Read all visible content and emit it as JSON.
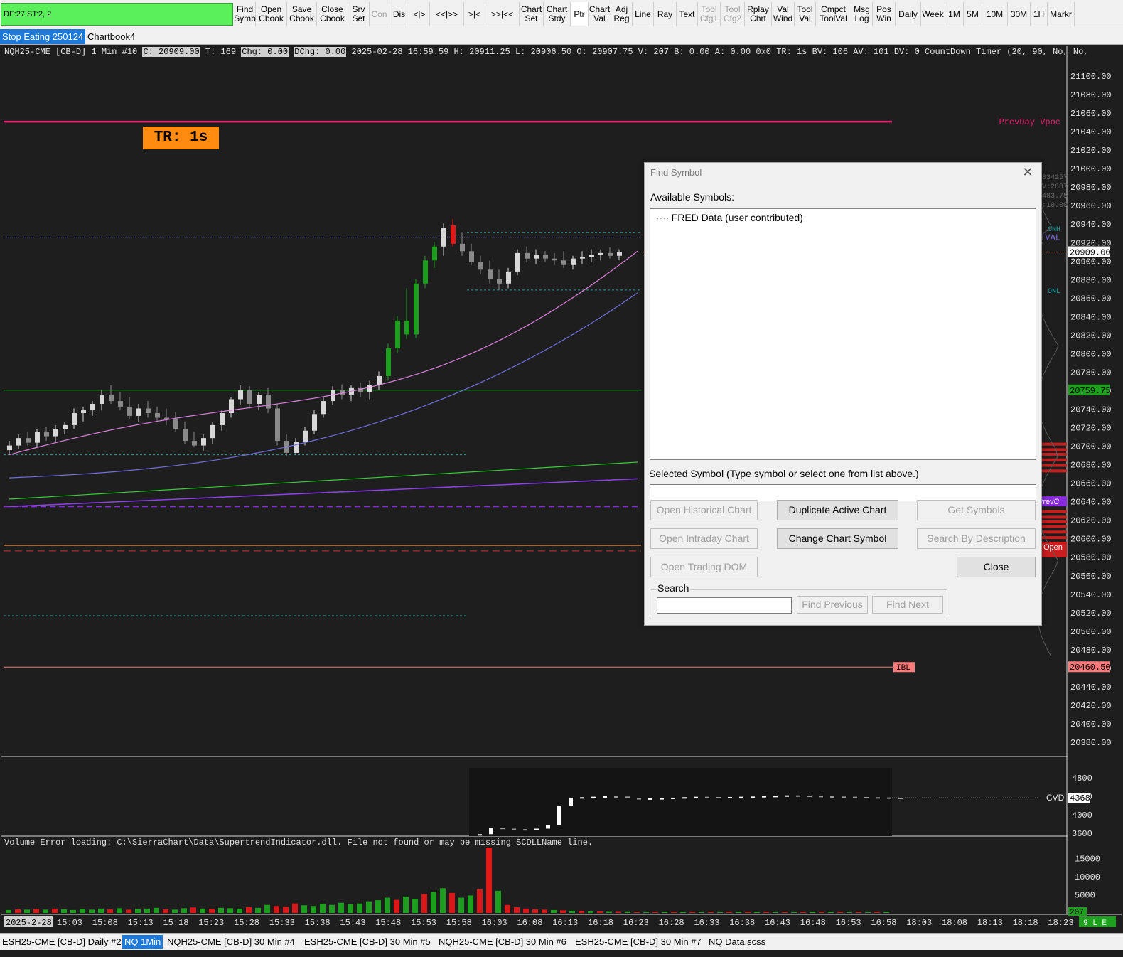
{
  "toolbar": {
    "status_text": "DF:27  ST:2, 2",
    "buttons": [
      {
        "label": "Find\nSymb"
      },
      {
        "label": "Open\nCbook"
      },
      {
        "label": "Save\nCbook"
      },
      {
        "label": "Close\nCbook"
      },
      {
        "label": "Srv\nSet"
      },
      {
        "label": "Con"
      },
      {
        "label": "Dis"
      },
      {
        "label": "<|>"
      },
      {
        "label": "<<|>>"
      },
      {
        "label": ">|<"
      },
      {
        "label": ">>|<<"
      },
      {
        "label": "Chart\nSet"
      },
      {
        "label": "Chart\nStdy"
      },
      {
        "label": "Ptr"
      },
      {
        "label": "Chart\nVal"
      },
      {
        "label": "Adj\nReg"
      },
      {
        "label": "Line"
      },
      {
        "label": "Ray"
      },
      {
        "label": "Text"
      },
      {
        "label": "Tool\nCfg1"
      },
      {
        "label": "Tool\nCfg2"
      },
      {
        "label": "Rplay\nChrt"
      },
      {
        "label": "Val\nWind"
      },
      {
        "label": "Tool\nVal"
      },
      {
        "label": "Cmpct\nToolVal"
      },
      {
        "label": "Msg\nLog"
      },
      {
        "label": "Pos\nWin"
      },
      {
        "label": "Daily"
      },
      {
        "label": "Week"
      },
      {
        "label": "1M"
      },
      {
        "label": "5M"
      },
      {
        "label": "10M"
      },
      {
        "label": "30M"
      },
      {
        "label": "1H"
      },
      {
        "label": "Markr"
      }
    ]
  },
  "chartbook_tabs": [
    "Stop Eating 250124",
    "Chartbook4"
  ],
  "chart": {
    "header": {
      "symbol": "NQH25-CME [CB-D]  1 Min  #10",
      "close": "C: 20909.00",
      "trades": "T: 169",
      "chg": "Chg: 0.00",
      "dchg": "DChg: 0.00",
      "rest": "2025-02-28 16:59:59 H: 20911.25 L: 20906.50 O: 20907.75 V: 207 B: 0.00 A: 0.00 0x0 TR: 1s BV: 106 AV: 101 DV: 0 CountDown Timer   (20, 90, No, No,"
    },
    "tr_badge": "TR:  1s",
    "price_axis": [
      "21100.00",
      "21080.00",
      "21060.00",
      "21040.00",
      "21020.00",
      "21000.00",
      "20980.00",
      "20960.00",
      "20940.00",
      "20920.00",
      "20900.00",
      "20880.00",
      "20860.00",
      "20840.00",
      "20820.00",
      "20800.00",
      "20780.00",
      "20760.00",
      "20740.00",
      "20720.00",
      "20700.00",
      "20680.00",
      "20660.00",
      "20640.00",
      "20620.00",
      "20600.00",
      "20580.00",
      "20560.00",
      "20540.00",
      "20520.00",
      "20500.00",
      "20480.00",
      "20460.00",
      "20440.00",
      "20420.00",
      "20400.00",
      "20380.00"
    ],
    "price_markers": [
      {
        "text": "20909.00",
        "bg": "#ffffff",
        "fg": "#000000"
      },
      {
        "text": "20759.75",
        "bg": "#1ea01e",
        "fg": "#000000"
      },
      {
        "text": "20460.50",
        "bg": "#ff7a7a",
        "fg": "#000000"
      }
    ],
    "line_labels": {
      "prevday_vpoc": "PrevDay Vpoc",
      "val": "y VAL",
      "onh": "ONH",
      "onl": "ONL",
      "prevc": "PrevC",
      "open": "Open",
      "ibl": "IBL"
    },
    "partial_values": [
      ":834257",
      "BV:2887",
      ":483.75",
      "%:10.00"
    ],
    "cvd_label": "CVD",
    "cvd_axis": [
      "4800",
      "4400",
      "4000",
      "3600"
    ],
    "cvd_marker": "4368",
    "volume_axis": [
      "15000",
      "10000",
      "5000"
    ],
    "volume_marker": "207",
    "error_text": "Volume  Error loading: C:\\SierraChart\\Data\\SupertrendIndicator.dll. File not found or may be missing SCDLLName line.",
    "time_axis": [
      "2025-2-28",
      "15:03",
      "15:08",
      "15:13",
      "15:18",
      "15:23",
      "15:28",
      "15:33",
      "15:38",
      "15:43",
      "15:48",
      "15:53",
      "15:58",
      "16:03",
      "16:08",
      "16:13",
      "16:18",
      "16:23",
      "16:28",
      "16:33",
      "16:38",
      "16:43",
      "16:48",
      "16:53",
      "16:58",
      "18:03",
      "18:08",
      "18:13",
      "18:18",
      "18:23"
    ],
    "corner_status": "9 L E"
  },
  "bottom_tabs": [
    {
      "label": "ESH25-CME [CB-D]  Daily #2",
      "active": false
    },
    {
      "label": "NQ 1Min",
      "active": true
    },
    {
      "label": "NQH25-CME [CB-D]  30 Min  #4",
      "active": false
    },
    {
      "label": "ESH25-CME [CB-D]  30 Min  #5",
      "active": false
    },
    {
      "label": "NQH25-CME [CB-D]  30 Min  #6",
      "active": false
    },
    {
      "label": "ESH25-CME [CB-D]  30 Min  #7",
      "active": false
    },
    {
      "label": "NQ Data.scss",
      "active": false
    }
  ],
  "dialog": {
    "title": "Find Symbol",
    "available_label": "Available Symbols:",
    "tree_item": "FRED Data (user contributed)",
    "selected_label": "Selected Symbol (Type symbol or select one from list above.)",
    "selected_value": "",
    "btn_open_historical": "Open Historical Chart",
    "btn_duplicate": "Duplicate Active Chart",
    "btn_get_symbols": "Get Symbols",
    "btn_open_intraday": "Open Intraday Chart",
    "btn_change_symbol": "Change Chart Symbol",
    "btn_search_desc": "Search By Description",
    "btn_open_dom": "Open Trading DOM",
    "btn_close": "Close",
    "search_label": "Search",
    "search_value": "",
    "btn_find_prev": "Find Previous",
    "btn_find_next": "Find Next"
  }
}
